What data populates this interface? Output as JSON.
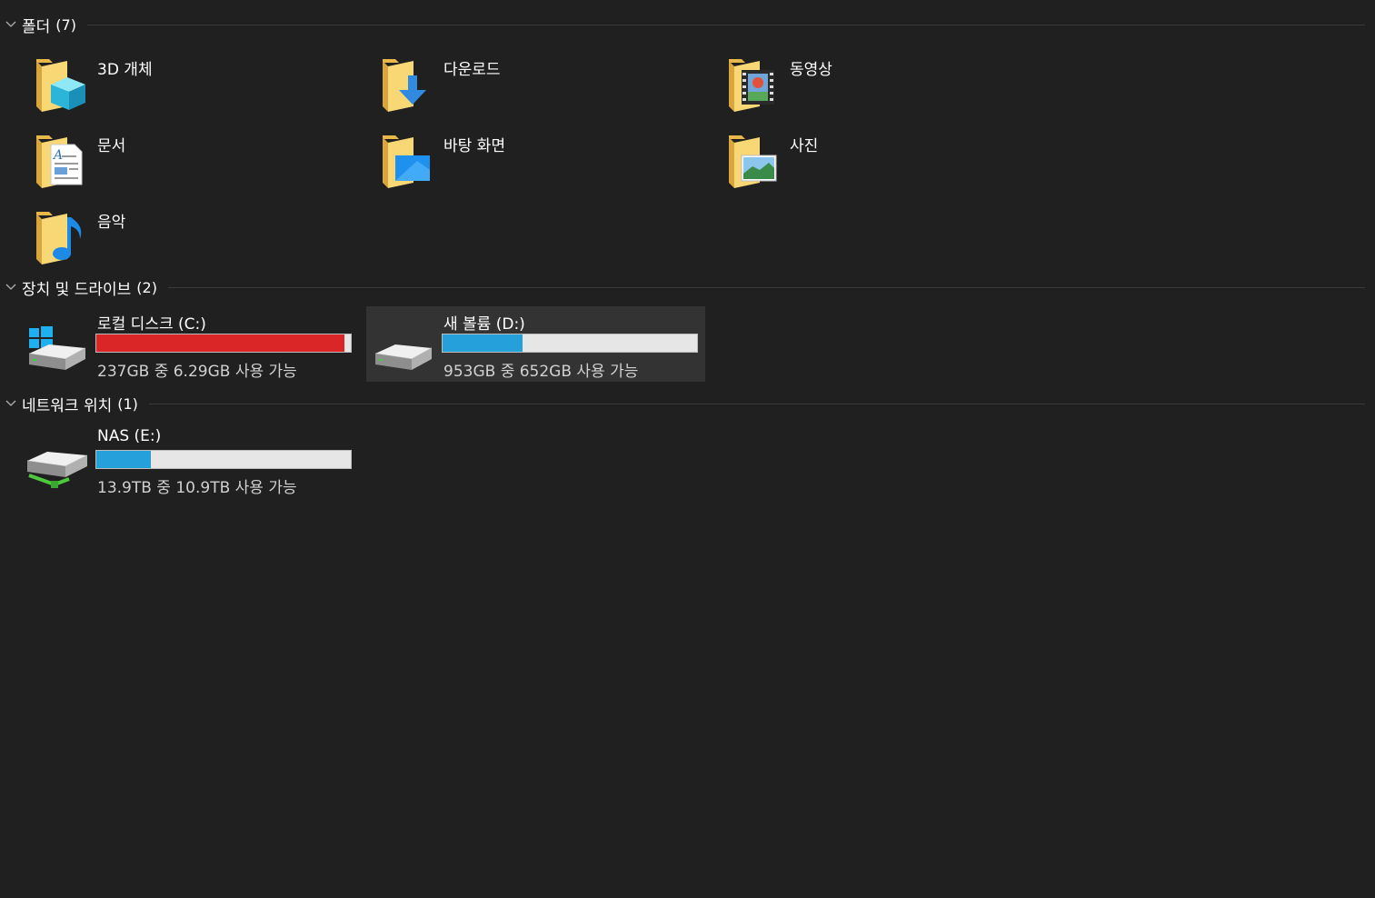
{
  "sections": {
    "folders": {
      "title": "폴더",
      "count": "(7)"
    },
    "devices": {
      "title": "장치 및 드라이브",
      "count": "(2)"
    },
    "network": {
      "title": "네트워크 위치",
      "count": "(1)"
    }
  },
  "folders": [
    {
      "label": "3D 개체",
      "icon": "3d-objects-folder-icon"
    },
    {
      "label": "다운로드",
      "icon": "downloads-folder-icon"
    },
    {
      "label": "동영상",
      "icon": "videos-folder-icon"
    },
    {
      "label": "문서",
      "icon": "documents-folder-icon"
    },
    {
      "label": "바탕 화면",
      "icon": "desktop-folder-icon"
    },
    {
      "label": "사진",
      "icon": "pictures-folder-icon"
    },
    {
      "label": "음악",
      "icon": "music-folder-icon"
    }
  ],
  "drives": [
    {
      "name": "로컬 디스크 (C:)",
      "info": "237GB 중 6.29GB 사용 가능",
      "used_fraction": 0.974,
      "bar_color": "#da2626",
      "icon": "windows-drive-icon"
    },
    {
      "name": "새 볼륨 (D:)",
      "info": "953GB 중 652GB 사용 가능",
      "used_fraction": 0.316,
      "bar_color": "#26a0da",
      "icon": "drive-icon"
    }
  ],
  "network_drives": [
    {
      "name": "NAS (E:)",
      "info": "13.9TB 중 10.9TB 사용 가능",
      "used_fraction": 0.216,
      "bar_color": "#26a0da",
      "icon": "network-drive-icon"
    }
  ],
  "colors": {
    "background": "#202020",
    "selected": "#333333",
    "bar_track": "#e6e6e6",
    "folder_yellow": "#f8d775"
  }
}
